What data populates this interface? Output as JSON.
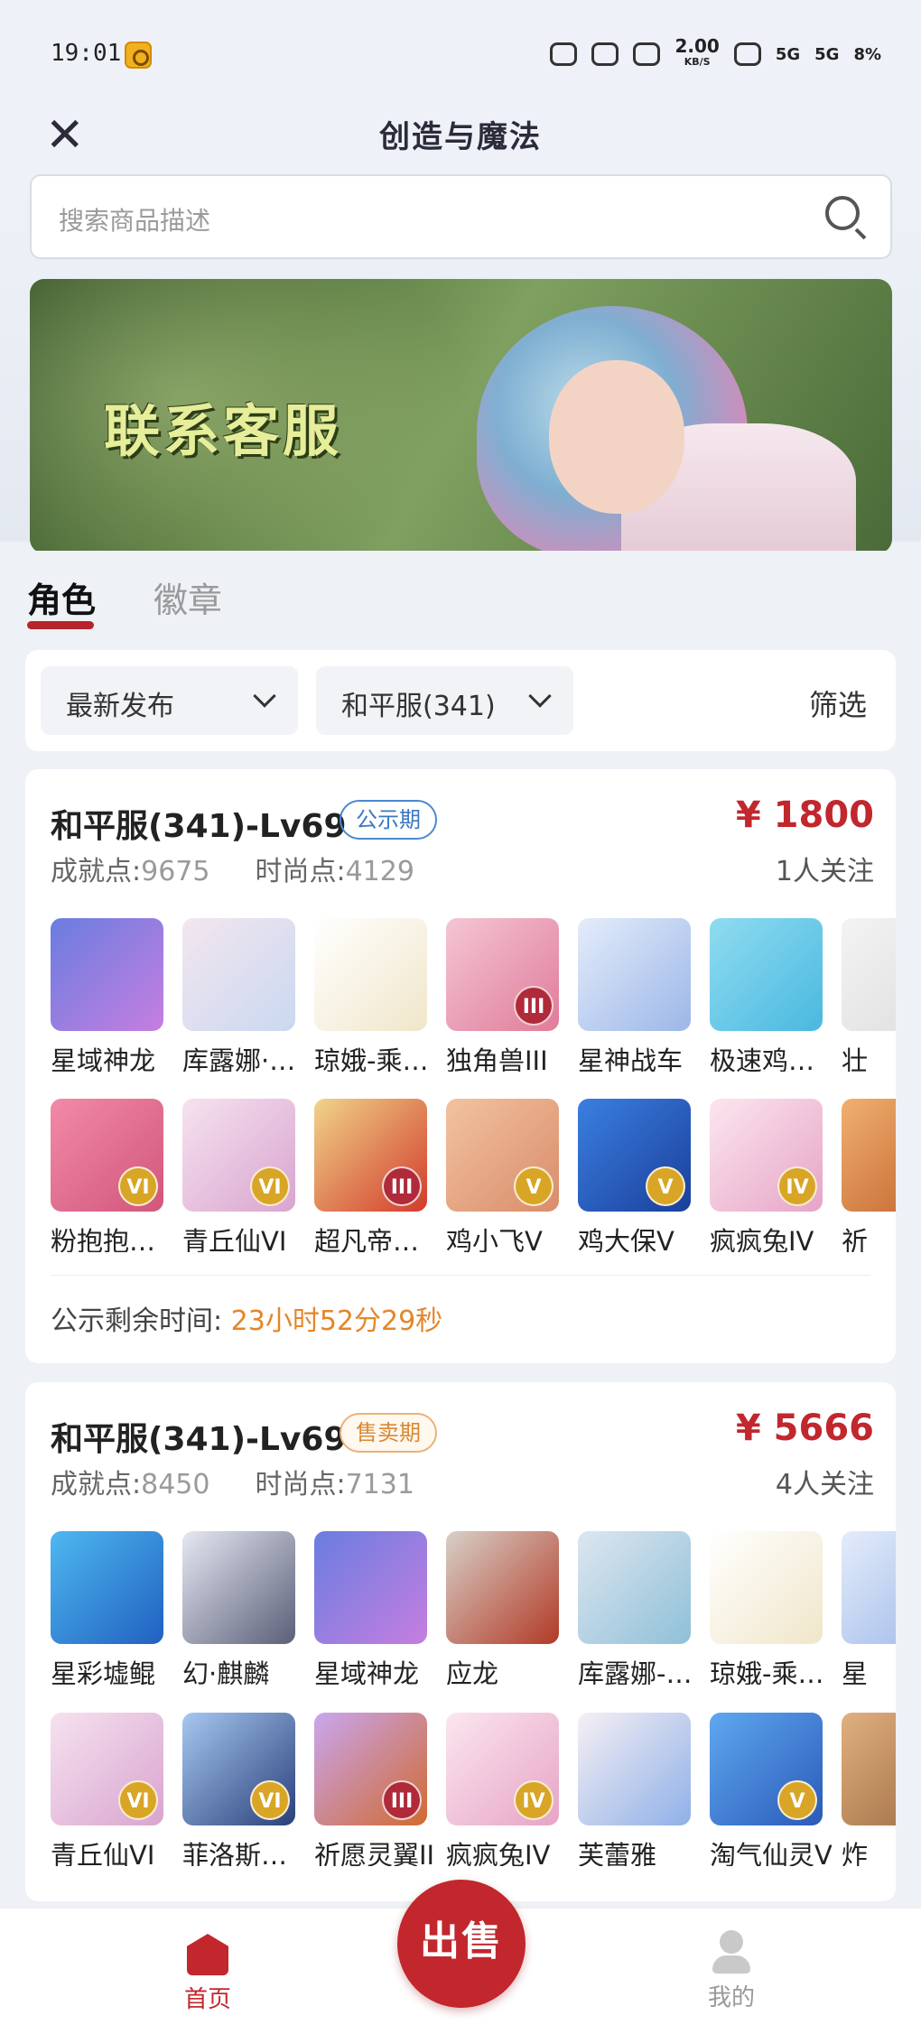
{
  "status": {
    "time": "19:01",
    "speed": "2.00",
    "speed_unit": "KB/S",
    "sig1": "5G",
    "sig2": "5G",
    "battery": "8%"
  },
  "header": {
    "title": "创造与魔法",
    "close": "✕"
  },
  "search": {
    "placeholder": "搜索商品描述"
  },
  "banner": {
    "text": "联系客服"
  },
  "tabs": [
    {
      "label": "角色"
    },
    {
      "label": "徽章"
    }
  ],
  "filters": {
    "sort": "最新发布",
    "server": "和平服(341)",
    "filter": "筛选"
  },
  "listings": [
    {
      "name": "和平服(341)-Lv69",
      "badge": "公示期",
      "price": "¥ 1800",
      "followers": "1人关注",
      "achieve_label": "成就点:",
      "achieve": "9675",
      "fashion_label": "时尚点:",
      "fashion": "4129",
      "row1": [
        {
          "label": "星域神龙",
          "c1": "#6a7de0",
          "c2": "#c57ee0",
          "tier": ""
        },
        {
          "label": "库露娜·…",
          "c1": "#f3e6ef",
          "c2": "#c9d8f0",
          "tier": ""
        },
        {
          "label": "琼娥-乘…",
          "c1": "#ffffff",
          "c2": "#f0e6c9",
          "tier": ""
        },
        {
          "label": "独角兽III",
          "c1": "#f4c6d3",
          "c2": "#e07b9a",
          "tier": "III"
        },
        {
          "label": "星神战车",
          "c1": "#e4ecfa",
          "c2": "#9cb7e8",
          "tier": ""
        },
        {
          "label": "极速鸡…",
          "c1": "#8fdcf0",
          "c2": "#4ab8e0",
          "tier": ""
        },
        {
          "label": "壮",
          "c1": "#f3f3f3",
          "c2": "#dddddd",
          "tier": ""
        }
      ],
      "row2": [
        {
          "label": "粉抱抱…",
          "c1": "#f28aa8",
          "c2": "#d1567b",
          "tier": "VI"
        },
        {
          "label": "青丘仙VI",
          "c1": "#f6e2ef",
          "c2": "#d9a4cf",
          "tier": "VI"
        },
        {
          "label": "超凡帝…",
          "c1": "#f0d48a",
          "c2": "#d23b2b",
          "tier": "III"
        },
        {
          "label": "鸡小飞V",
          "c1": "#f2c3a0",
          "c2": "#d98c6a",
          "tier": "V"
        },
        {
          "label": "鸡大保V",
          "c1": "#3b7fe0",
          "c2": "#1a3f9c",
          "tier": "V"
        },
        {
          "label": "疯疯兔IV",
          "c1": "#fbe6ef",
          "c2": "#e7a4c6",
          "tier": "IV"
        },
        {
          "label": "祈",
          "c1": "#f0b070",
          "c2": "#c0602a",
          "tier": ""
        }
      ],
      "countdown_label": "公示剩余时间:",
      "countdown": "23小时52分29秒"
    },
    {
      "name": "和平服(341)-Lv69",
      "badge": "售卖期",
      "price": "¥ 5666",
      "followers": "4人关注",
      "achieve_label": "成就点:",
      "achieve": "8450",
      "fashion_label": "时尚点:",
      "fashion": "7131",
      "row1": [
        {
          "label": "星彩墟鲲",
          "c1": "#4fb8f0",
          "c2": "#2060c0",
          "tier": ""
        },
        {
          "label": "幻·麒麟",
          "c1": "#e6e8f2",
          "c2": "#5a5f78",
          "tier": ""
        },
        {
          "label": "星域神龙",
          "c1": "#6a7de0",
          "c2": "#c57ee0",
          "tier": ""
        },
        {
          "label": "应龙",
          "c1": "#d8d0c8",
          "c2": "#b23a26",
          "tier": ""
        },
        {
          "label": "库露娜-…",
          "c1": "#dde6f0",
          "c2": "#8fc0d8",
          "tier": ""
        },
        {
          "label": "琼娥-乘…",
          "c1": "#ffffff",
          "c2": "#f0e6c9",
          "tier": ""
        },
        {
          "label": "星",
          "c1": "#e4ecfa",
          "c2": "#9cb7e8",
          "tier": ""
        }
      ],
      "row2": [
        {
          "label": "青丘仙VI",
          "c1": "#f6e2ef",
          "c2": "#d9a4cf",
          "tier": "VI"
        },
        {
          "label": "菲洛斯…",
          "c1": "#a6c8f0",
          "c2": "#2a3f7a",
          "tier": "VI"
        },
        {
          "label": "祈愿灵翼III",
          "c1": "#c9a6f0",
          "c2": "#d06a30",
          "tier": "III"
        },
        {
          "label": "疯疯兔IV",
          "c1": "#fbe6ef",
          "c2": "#e7a4c6",
          "tier": "IV"
        },
        {
          "label": "芙蕾雅",
          "c1": "#f6f0f4",
          "c2": "#8fb0e8",
          "tier": ""
        },
        {
          "label": "淘气仙灵V",
          "c1": "#5fa8f0",
          "c2": "#2a5ab8",
          "tier": "V"
        },
        {
          "label": "炸",
          "c1": "#e0b080",
          "c2": "#9a6a40",
          "tier": ""
        }
      ]
    }
  ],
  "bottom_nav": {
    "home": "首页",
    "sell": "出售",
    "me": "我的"
  }
}
